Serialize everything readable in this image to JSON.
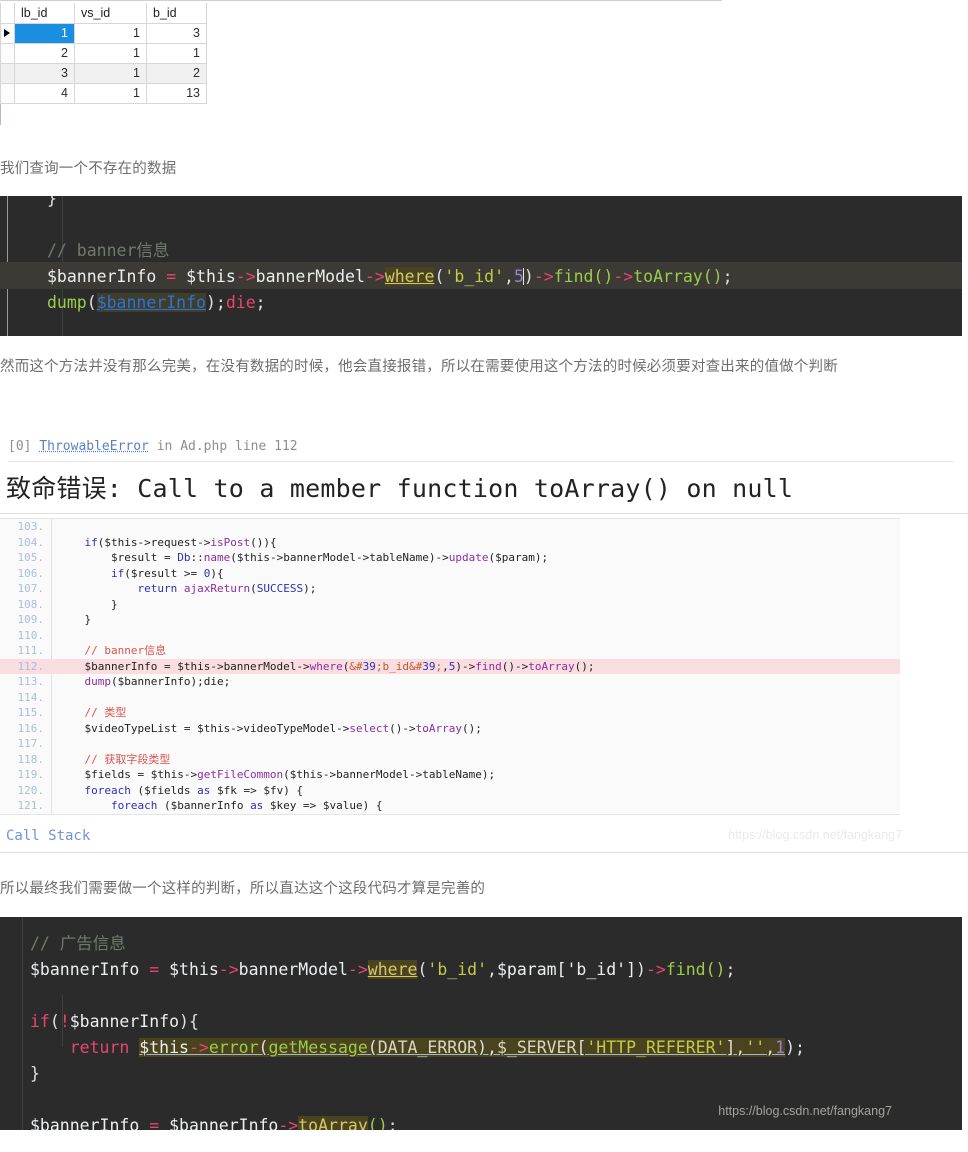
{
  "result_grid": {
    "columns": [
      "lb_id",
      "vs_id",
      "b_id"
    ],
    "rows": [
      {
        "lb_id": "1",
        "vs_id": "1",
        "b_id": "3",
        "selected": true
      },
      {
        "lb_id": "2",
        "vs_id": "1",
        "b_id": "1",
        "selected": false
      },
      {
        "lb_id": "3",
        "vs_id": "1",
        "b_id": "2",
        "selected": false
      },
      {
        "lb_id": "4",
        "vs_id": "1",
        "b_id": "13",
        "selected": false
      }
    ],
    "selection_color": "#1a8fe0",
    "row_marker_icon": "play-triangle-icon"
  },
  "paragraphs": {
    "p1": "我们查询一个不存在的数据",
    "p2": "然而这个方法并没有那么完美，在没有数据的时候，他会直接报错，所以在需要使用这个方法的时候必须要对查出来的值做个判断",
    "p3": "所以最终我们需要做一个这样的判断，所以直达这个这段代码才算是完善的"
  },
  "editor_top": {
    "theme_bg": "#2b2b2b",
    "lines": {
      "l1": "}",
      "comment": "// banner信息",
      "code_var": "$bannerInfo",
      "code_eq": "=",
      "code_this": "$this",
      "arrow": "->",
      "model": "bannerModel",
      "where": "where",
      "arg_str": "'b_id'",
      "arg_num": "5",
      "find": "find",
      "toArray": "toArray",
      "dump": "dump",
      "dump_arg": "$bannerInfo",
      "die": "die"
    }
  },
  "error_panel": {
    "header": {
      "index": "[0]",
      "type": "ThrowableError",
      "in": "in",
      "file": "Ad.php",
      "line_label": "line",
      "line_no": "112"
    },
    "message": "致命错误: Call to a member function toArray() on null",
    "call_stack_label": "Call Stack",
    "watermark": "https://blog.csdn.net/fangkang7",
    "highlight_line": 112,
    "source_lines": [
      {
        "no": "103.",
        "text": ""
      },
      {
        "no": "104.",
        "text": "    if($this->request->isPost()){"
      },
      {
        "no": "105.",
        "text": "        $result = Db::name($this->bannerModel->tableName)->update($param);"
      },
      {
        "no": "106.",
        "text": "        if($result >= 0){"
      },
      {
        "no": "107.",
        "text": "            return ajaxReturn(SUCCESS);"
      },
      {
        "no": "108.",
        "text": "        }"
      },
      {
        "no": "109.",
        "text": "    }"
      },
      {
        "no": "110.",
        "text": ""
      },
      {
        "no": "111.",
        "text": "    // banner信息"
      },
      {
        "no": "112.",
        "text": "    $bannerInfo = $this->bannerModel->where('b_id',5)->find()->toArray();"
      },
      {
        "no": "113.",
        "text": "    dump($bannerInfo);die;"
      },
      {
        "no": "114.",
        "text": ""
      },
      {
        "no": "115.",
        "text": "    // 类型"
      },
      {
        "no": "116.",
        "text": "    $videoTypeList = $this->videoTypeModel->select()->toArray();"
      },
      {
        "no": "117.",
        "text": ""
      },
      {
        "no": "118.",
        "text": "    // 获取字段类型"
      },
      {
        "no": "119.",
        "text": "    $fields = $this->getFileCommon($this->bannerModel->tableName);"
      },
      {
        "no": "120.",
        "text": "    foreach ($fields as $fk => $fv) {"
      },
      {
        "no": "121.",
        "text": "        foreach ($bannerInfo as $key => $value) {"
      }
    ]
  },
  "editor_bottom": {
    "theme_bg": "#2b2b2b",
    "watermark": "https://blog.csdn.net/fangkang7",
    "lines": {
      "comment": "// 广告信息",
      "var": "$bannerInfo",
      "this": "$this",
      "model": "bannerModel",
      "where": "where",
      "str_bid": "'b_id'",
      "param": "$param['b_id']",
      "find": "find",
      "if_kw": "if",
      "not": "!",
      "return_kw": "return",
      "error": "error",
      "getMessage": "getMessage",
      "data_error": "DATA_ERROR",
      "server": "$_SERVER",
      "referer": "'HTTP_REFERER'",
      "empty_str": "''",
      "one": "1",
      "toArray": "toArray",
      "close_brace": "}"
    }
  }
}
